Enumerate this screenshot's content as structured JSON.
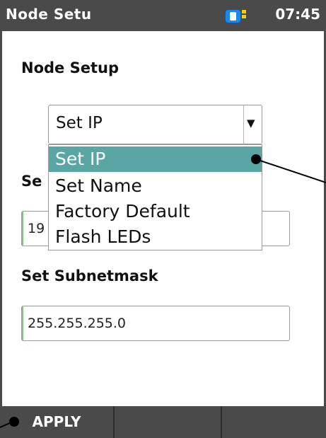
{
  "titlebar": {
    "title": "Node Setu",
    "time": "07:45"
  },
  "node_setup": {
    "heading": "Node Setup",
    "select_value": "Set IP",
    "options": [
      "Set IP",
      "Set Name",
      "Factory Default",
      "Flash LEDs"
    ],
    "selected_index": 0
  },
  "set_ip": {
    "label_partial": "Se",
    "value_partial": "19"
  },
  "subnet": {
    "label": "Set Subnetmask",
    "value": "255.255.255.0"
  },
  "softkeys": [
    "APPLY",
    "",
    ""
  ],
  "colors": {
    "bar": "#4a4a4a",
    "highlight": "#5aa6a4",
    "battery": "#1e88e5",
    "battery_plug": "#f5d100"
  }
}
